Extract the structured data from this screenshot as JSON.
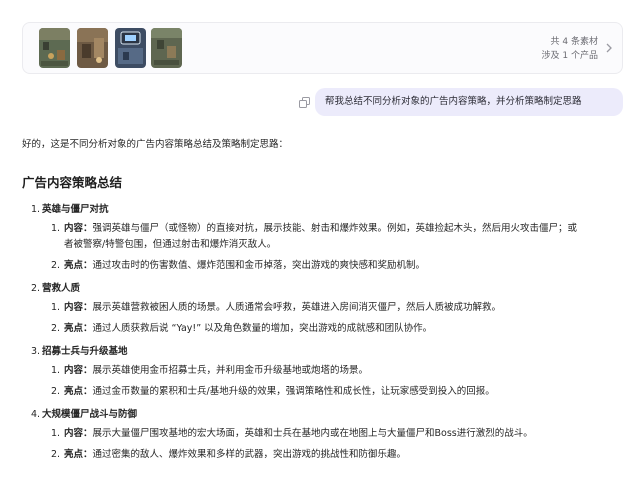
{
  "assets": {
    "count_label": "共 4 条素材",
    "products_label": "涉及 1 个产品"
  },
  "chat": {
    "user_message": "帮我总结不同分析对象的广告内容策略，并分析策略制定思路",
    "reply": {
      "intro": "好的，这是不同分析对象的广告内容策略总结及策略制定思路：",
      "heading": "广告内容策略总结",
      "sections": [
        {
          "num": "1.",
          "title": "英雄与僵尸对抗",
          "items": [
            {
              "num": "1.",
              "key": "内容：",
              "text": "强调英雄与僵尸（或怪物）的直接对抗，展示技能、射击和爆炸效果。例如，英雄捡起木头，然后用火攻击僵尸；或者被警察/特警包围，但通过射击和爆炸消灭敌人。"
            },
            {
              "num": "2.",
              "key": "亮点：",
              "text": "通过攻击时的伤害数值、爆炸范围和金币掉落，突出游戏的爽快感和奖励机制。"
            }
          ]
        },
        {
          "num": "2.",
          "title": "营救人质",
          "items": [
            {
              "num": "1.",
              "key": "内容：",
              "text": "展示英雄营救被困人质的场景。人质通常会呼救，英雄进入房间消灭僵尸，然后人质被成功解救。"
            },
            {
              "num": "2.",
              "key": "亮点：",
              "text": "通过人质获救后说 “Yay!” 以及角色数量的增加，突出游戏的成就感和团队协作。"
            }
          ]
        },
        {
          "num": "3.",
          "title": "招募士兵与升级基地",
          "items": [
            {
              "num": "1.",
              "key": "内容：",
              "text": "展示英雄使用金币招募士兵，并利用金币升级基地或炮塔的场景。"
            },
            {
              "num": "2.",
              "key": "亮点：",
              "text": "通过金币数量的累积和士兵/基地升级的效果，强调策略性和成长性，让玩家感受到投入的回报。"
            }
          ]
        },
        {
          "num": "4.",
          "title": "大规模僵尸战斗与防御",
          "items": [
            {
              "num": "1.",
              "key": "内容：",
              "text": "展示大量僵尸围攻基地的宏大场面，英雄和士兵在基地内或在地图上与大量僵尸和Boss进行激烈的战斗。"
            },
            {
              "num": "2.",
              "key": "亮点：",
              "text": "通过密集的敌人、爆炸效果和多样的武器，突出游戏的挑战性和防御乐趣。"
            }
          ]
        }
      ]
    }
  },
  "colors": {
    "bubble_bg": "#ecebfb",
    "text": "#262626",
    "muted": "#6b6b72"
  }
}
